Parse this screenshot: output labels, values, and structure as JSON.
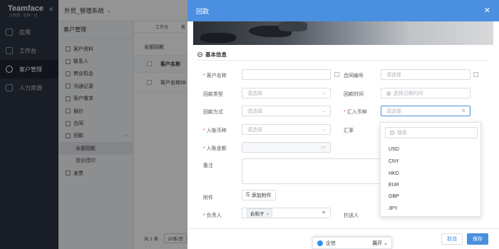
{
  "brand": {
    "name": "Teamface",
    "tagline": "云数据 · 连接一切"
  },
  "nav": [
    {
      "label": "应用",
      "icon": "grid-icon"
    },
    {
      "label": "工作台",
      "icon": "workbench-icon"
    },
    {
      "label": "客户管理",
      "icon": "people-icon"
    },
    {
      "label": "人力资源",
      "icon": "person-icon"
    }
  ],
  "topbar": {
    "system_name": "外贸_管理系统"
  },
  "submenu": {
    "title": "客户管理",
    "items": [
      "客户资料",
      "联系人",
      "商业机会",
      "沟通记录",
      "客户需求",
      "报价",
      "合同",
      "回款"
    ],
    "children": [
      "全部回款",
      "我创建的"
    ],
    "extra": "发票"
  },
  "list": {
    "tabs": [
      "工作台",
      "客"
    ],
    "view_title": "全部回款",
    "column": "客户名称",
    "row": "客户名称08",
    "total": "共 1 条",
    "page_size": "20条/页"
  },
  "drawer": {
    "title": "回款",
    "section": "基本信息",
    "fields": {
      "customer_name": {
        "label": "客户名称",
        "required": true
      },
      "contract_no": {
        "label": "合同编号",
        "placeholder": "请选择"
      },
      "payment_type": {
        "label": "回款类型",
        "placeholder": "请选择"
      },
      "payment_time": {
        "label": "回款时间",
        "placeholder": "选择日期时间"
      },
      "payment_method": {
        "label": "回款方式",
        "placeholder": "请选择"
      },
      "remit_currency": {
        "label": "汇入币种",
        "placeholder": "请选择",
        "required": true
      },
      "account_currency": {
        "label": "入账币种",
        "placeholder": "请选择",
        "required": true
      },
      "exchange_rate": {
        "label": "汇率"
      },
      "account_amount": {
        "label": "入账金额",
        "required": true
      },
      "remark": {
        "label": "备注"
      },
      "attachment": {
        "label": "附件",
        "button": "添加附件"
      },
      "owner": {
        "label": "负责人",
        "required": true,
        "value": "俞和子"
      },
      "cc": {
        "label": "抄送人"
      }
    },
    "currency_dropdown": {
      "search_placeholder": "搜索",
      "options": [
        "USD",
        "CNY",
        "HKD",
        "EUR",
        "GBP",
        "JPY"
      ]
    },
    "footer": {
      "cancel": "取消",
      "save": "保存"
    }
  },
  "qixin": {
    "label": "企信",
    "expand": "展开"
  },
  "colors": {
    "primary": "#4a8fe0",
    "sidebar": "#2c3341",
    "required": "#e04848"
  }
}
